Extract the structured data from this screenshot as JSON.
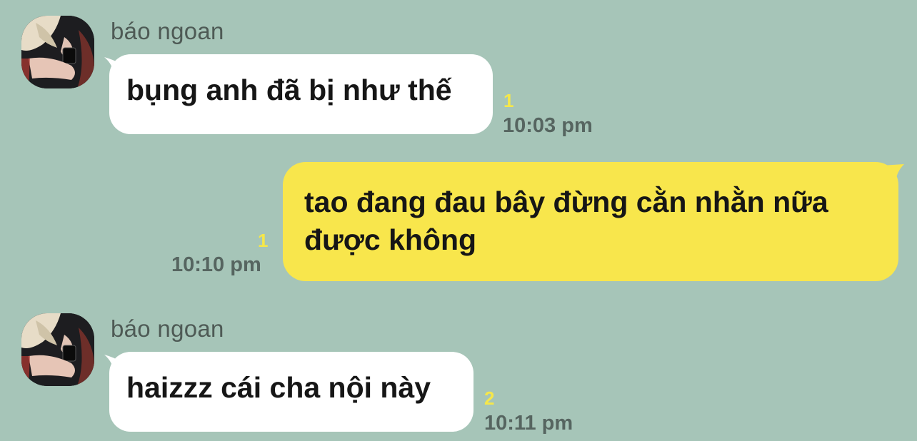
{
  "messages": [
    {
      "sender": "báo ngoan",
      "text": "bụng anh đã bị như thế",
      "unread_count": "1",
      "time": "10:03 pm"
    },
    {
      "text_line1": "tao đang đau bây đừng cằn nhằn nữa",
      "text_line2": "được không",
      "unread_count": "1",
      "time": "10:10 pm"
    },
    {
      "sender": "báo ngoan",
      "text": "haizzz cái cha nội này",
      "unread_count": "2",
      "time": "10:11 pm"
    }
  ],
  "colors": {
    "background": "#a6c5b8",
    "incoming_bubble": "#ffffff",
    "outgoing_bubble": "#f8e64c",
    "unread": "#f5e74a",
    "time": "#566560"
  }
}
